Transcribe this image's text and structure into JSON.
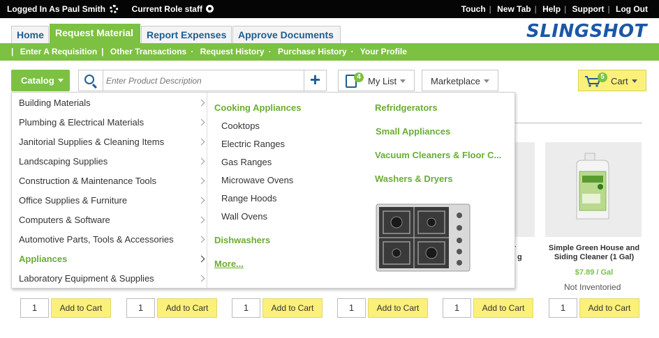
{
  "topbar": {
    "logged_in_label": "Logged In As",
    "user_name": "Paul Smith",
    "role_label": "Current Role",
    "role_value": "staff",
    "links": [
      "Touch",
      "New Tab",
      "Help",
      "Support",
      "Log Out"
    ]
  },
  "tabs": [
    "Home",
    "Request Material",
    "Report Expenses",
    "Approve Documents"
  ],
  "logo": "SLINGSHOT",
  "subnav": [
    "Enter A Requisition",
    "Other Transactions",
    "Request History",
    "Purchase History",
    "Your Profile"
  ],
  "toolbar": {
    "catalog_label": "Catalog",
    "search_placeholder": "Enter Product Description",
    "add_symbol": "+",
    "mylist_label": "My List",
    "mylist_count": "4",
    "marketplace_label": "Marketplace",
    "cart_label": "Cart",
    "cart_count": "5"
  },
  "categories": [
    "Building Materials",
    "Plumbing & Electrical Materials",
    "Janitorial Supplies & Cleaning Items",
    "Landscaping Supplies",
    "Construction & Maintenance Tools",
    "Office Supplies & Furniture",
    "Computers & Software",
    "Automotive Parts, Tools & Accessories",
    "Appliances",
    "Laboratory Equipment & Supplies"
  ],
  "active_category": "Appliances",
  "submenu": {
    "cooking_heading": "Cooking Appliances",
    "cooking_items": [
      "Cooktops",
      "Electric Ranges",
      "Gas Ranges",
      "Microwave Ovens",
      "Range Hoods",
      "Wall Ovens"
    ],
    "dishwashers": "Dishwashers",
    "more": "More...",
    "right_headings": [
      "Refridgerators",
      "Small Appliances",
      "Vacuum Cleaners & Floor C...",
      "Washers & Dryers"
    ],
    "image_icon": "cooktop-image"
  },
  "products": {
    "visible_title": "Simple Green House and Siding Cleaner (1 Gal)",
    "visible_price": "$7.89 / Gal",
    "not_inventoried": "Not Inventoried",
    "partial_texts": [
      "r",
      "g"
    ],
    "quantity": "1",
    "add_to_cart": "Add to Cart"
  }
}
